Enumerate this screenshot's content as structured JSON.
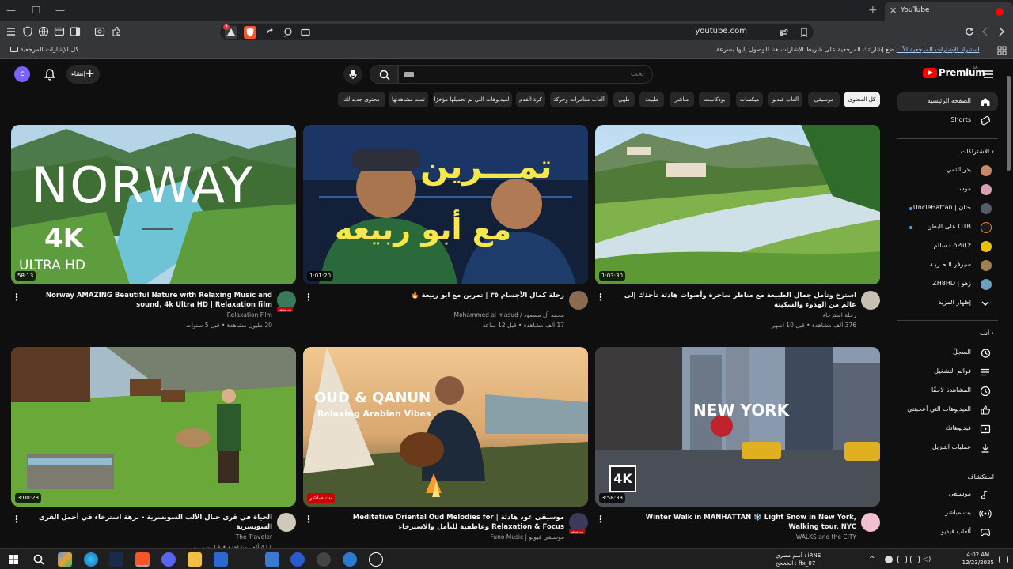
{
  "browser": {
    "tab_title": "YouTube",
    "url": "youtube.com",
    "bookmarks_all": "كل الإشارات المرجعية",
    "bookmarks_hint": "ضع إشاراتك المرجعية على شريط الإشارات هنا للوصول إليها بسرعة.",
    "bookmarks_import": "استيراد الإشارات المرجعية الآ...",
    "shield_badge": "2"
  },
  "masthead": {
    "avatar_letter": "c",
    "create_label": "إنشاء",
    "create_plus": "+",
    "search_placeholder": "بحث",
    "logo_text": "Premium",
    "logo_region": "SA"
  },
  "chips": [
    {
      "label": "محتوى جديد لك"
    },
    {
      "label": "تمت مشاهدتها"
    },
    {
      "label": "الفيديوهات التي تم تحميلها مؤخرًا"
    },
    {
      "label": "كرة القدم"
    },
    {
      "label": "ألعاب مغامرات وحركة"
    },
    {
      "label": "طهي"
    },
    {
      "label": "طبيعة"
    },
    {
      "label": "مباشر"
    },
    {
      "label": "بودكاست"
    },
    {
      "label": "ميكسات"
    },
    {
      "label": "ألعاب فيديو"
    },
    {
      "label": "موسيقى"
    },
    {
      "label": "كل المحتوى"
    }
  ],
  "sidebar": {
    "main": [
      {
        "label": "الصفحة الرئيسية",
        "icon": "home-icon"
      },
      {
        "label": "Shorts",
        "icon": "shorts-icon"
      }
    ],
    "subscriptions_header": "الاشتراكات",
    "subscriptions": [
      {
        "label": "بدر الثمي",
        "color": "#c98a6a",
        "dot": false
      },
      {
        "label": "موسا",
        "color": "#d9a0b0",
        "dot": false
      },
      {
        "label": "UncleHattan | حتان",
        "color": "#555b66",
        "dot": true
      },
      {
        "label": "على البطن OTB",
        "color": "#1a1a1a",
        "dot": true
      },
      {
        "label": "سالم - oPiiLz",
        "color": "#e6c200",
        "dot": false
      },
      {
        "label": "سيرفر الـحـربـة",
        "color": "#a08050",
        "dot": false
      },
      {
        "label": "ZH8HD | زهو",
        "color": "#6aa0c0",
        "dot": false
      }
    ],
    "show_more": "إظهار المزيد",
    "you_header": "أنت",
    "you": [
      {
        "label": "السجلّ",
        "icon": "history-icon"
      },
      {
        "label": "قوائم التشغيل",
        "icon": "playlists-icon"
      },
      {
        "label": "المشاهدة لاحقًا",
        "icon": "watch-later-icon"
      },
      {
        "label": "الفيديوهات التي أعجبتني",
        "icon": "like-icon"
      },
      {
        "label": "فيديوهاتك",
        "icon": "your-videos-icon"
      },
      {
        "label": "عمليات التنزيل",
        "icon": "downloads-icon"
      }
    ],
    "explore_header": "استكشاف",
    "explore": [
      {
        "label": "موسيقى",
        "icon": "music-icon"
      },
      {
        "label": "بث مباشر",
        "icon": "live-icon"
      },
      {
        "label": "ألعاب فيديو",
        "icon": "gaming-icon"
      }
    ]
  },
  "videos": [
    {
      "title": "استرخِ وتأمل جمال الطبيعة مع مناظر ساحرة وأصوات هادئة تأخذك إلى عالم من الهدوء والسكينة",
      "channel": "رحلة استرخاء",
      "meta": "376 ألف مشاهدة • قبل 10 أشهر",
      "duration": "1:03:30",
      "avatar_color": "#c8c0b0",
      "overlay": "",
      "live_badge": ""
    },
    {
      "title": "رحلة كمال الأجسام ٣٥ | تمرين مع ابو ربيعة 🔥",
      "channel": "محمد آل مسعود / Mohammed al masud",
      "meta": "17 ألف مشاهدة • قبل 12 ساعة",
      "duration": "1:01:20",
      "avatar_color": "#8a6a50",
      "overlay": "تمـــرين\nمع أبو ربيعه",
      "live_badge": ""
    },
    {
      "title": "Norway AMAZING Beautiful Nature with Relaxing Music and sound, 4k Ultra HD | Relaxation film",
      "channel": "Relaxation Film",
      "meta": "20 مليون مشاهدة • قبل 5 سنوات",
      "duration": "58:13",
      "avatar_color": "#3a7a5a",
      "overlay": "NORWAY|4K|ULTRA HD",
      "live_badge": "بث مباشر"
    },
    {
      "title": "Winter Walk in MANHATTAN ❄️ Light Snow in New York, Walking tour, NYC",
      "channel": "WALKS and the CITY",
      "meta": "",
      "duration": "3:58:38",
      "avatar_color": "#f0c0d0",
      "overlay": "NEW YORK|4K",
      "live_badge": ""
    },
    {
      "title": "موسيقى عود هادئة | Meditative Oriental Oud Melodies for Relaxation & Focus وعاطفية للتأمل والاسترخاء",
      "channel": "موسيقى فيونو | Funo Music",
      "meta": "",
      "duration": "",
      "avatar_color": "#3a3a5a",
      "overlay": "OUD & QANUN|Relaxing Arabian Vibes",
      "live_badge": "بث مباشر"
    },
    {
      "title": "الحياة في قرى جبال الألب السويسرية - نزهة استرخاء في أجمل القرى السويسرية",
      "channel": "The Traveler",
      "meta": "411 ألف مشاهدة • قبل شهرين",
      "duration": "3:00:28",
      "avatar_color": "#d0c8b8",
      "overlay": "",
      "live_badge": ""
    }
  ],
  "taskbar": {
    "time": "4:02 AM",
    "date": "12/23/2025",
    "tray_line1": "أسم مصري : iRNE",
    "tray_line2": "الخخخخ : ffx_07"
  }
}
